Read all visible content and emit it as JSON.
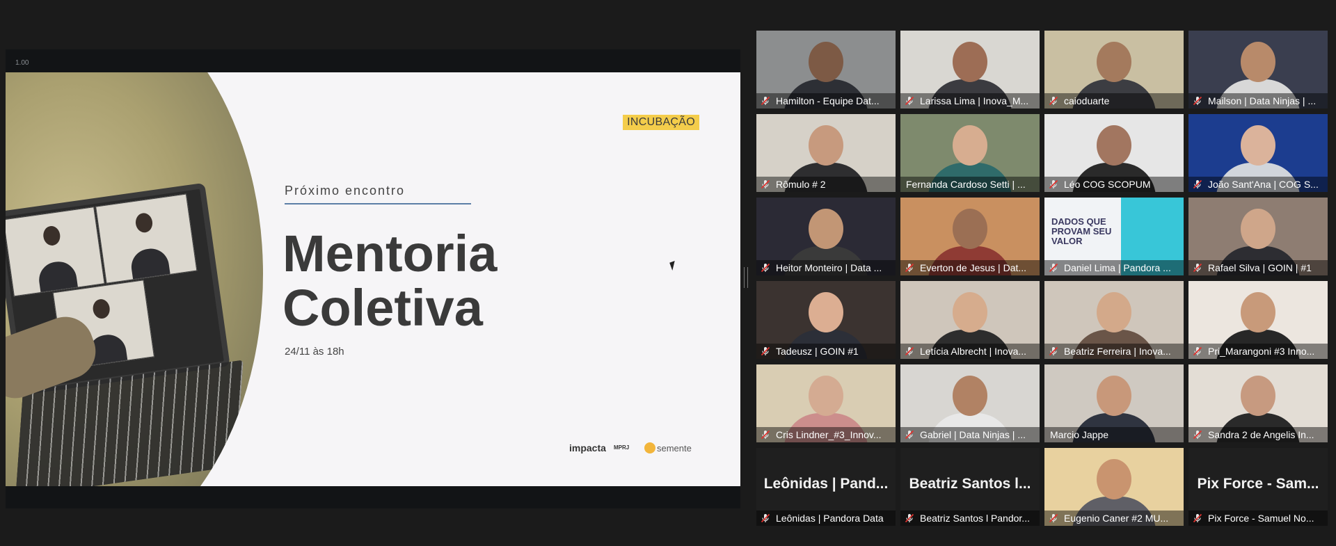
{
  "share": {
    "zoom_level": "1.00",
    "slide": {
      "badge": "INCUBAÇÃO",
      "kicker": "Próximo encontro",
      "title_line1": "Mentoria",
      "title_line2": "Coletiva",
      "date": "24/11 às 18h",
      "logo_impacta": "impacta",
      "logo_mprj": "MPRJ",
      "logo_semente": "semente"
    }
  },
  "gallery": {
    "tiles": [
      {
        "name": "Hamilton - Equipe Dat...",
        "muted": true,
        "bg": "#8c8e8f",
        "skin": "#7d5a45",
        "shirt": "#2d2f35"
      },
      {
        "name": "Larissa Lima | Inova_M...",
        "muted": true,
        "bg": "#d9d7d2",
        "skin": "#9d6d55",
        "shirt": "#3b3b40"
      },
      {
        "name": "caioduarte",
        "muted": true,
        "bg": "#c9bfa2",
        "skin": "#a47a5d",
        "shirt": "#3c3d42"
      },
      {
        "name": "Mailson | Data Ninjas | ...",
        "muted": true,
        "bg": "#3a3e4f",
        "skin": "#b88a6a",
        "shirt": "#d8d8d8"
      },
      {
        "name": "Rômulo # 2",
        "muted": true,
        "bg": "#d6d1c8",
        "skin": "#c79a7e",
        "shirt": "#2e2e30"
      },
      {
        "name": "Fernanda Cardoso Setti | ...",
        "muted": false,
        "bg": "#7e8a6d",
        "skin": "#d7ad90",
        "shirt": "#2f6b6a"
      },
      {
        "name": "Léo COG SCOPUM",
        "muted": true,
        "bg": "#e6e6e6",
        "skin": "#a27660",
        "shirt": "#2a2a2a"
      },
      {
        "name": "João Sant'Ana | COG S...",
        "muted": true,
        "bg": "#1c3d8f",
        "skin": "#dbb39b",
        "shirt": "#d1d5db"
      },
      {
        "name": "Heitor Monteiro | Data ...",
        "muted": true,
        "bg": "#2b2a35",
        "skin": "#c29675",
        "shirt": "#3a3a3a"
      },
      {
        "name": "Everton de Jesus | Dat...",
        "muted": true,
        "bg": "#c99060",
        "skin": "#9b6f54",
        "shirt": "#8f3b34"
      },
      {
        "name": "Daniel Lima | Pandora ...",
        "muted": true,
        "bg": "#f1f3f6",
        "skin": "",
        "shirt": "",
        "poster": true
      },
      {
        "name": "Rafael Silva | GOIN | #1",
        "muted": true,
        "bg": "#8e7d72",
        "skin": "#cfa68a",
        "shirt": "#2d2d32"
      },
      {
        "name": "Tadeusz | GOIN #1",
        "muted": true,
        "bg": "#3b3330",
        "skin": "#dcae92",
        "shirt": "#2c2f38"
      },
      {
        "name": "Letícia Albrecht | Inova...",
        "muted": true,
        "bg": "#cfc6bb",
        "skin": "#d6ac8d",
        "shirt": "#2d2d2d"
      },
      {
        "name": "Beatriz Ferreira | Inova...",
        "muted": true,
        "bg": "#cfc6bb",
        "skin": "#d3a98a",
        "shirt": "#6a5548"
      },
      {
        "name": "Pri_Marangoni #3 Inno...",
        "muted": true,
        "bg": "#ece6df",
        "skin": "#c89a7a",
        "shirt": "#272727"
      },
      {
        "name": "Cris Lindner_#3_Innov...",
        "muted": true,
        "bg": "#d9cdb3",
        "skin": "#d4ab92",
        "shirt": "#cc8e8c"
      },
      {
        "name": "Gabriel | Data Ninjas | ...",
        "muted": true,
        "bg": "#d8d6d2",
        "skin": "#b18264",
        "shirt": "#e8e8e8"
      },
      {
        "name": "Marcio Jappe",
        "muted": false,
        "bg": "#cfc9c1",
        "skin": "#c8987a",
        "shirt": "#2f3440",
        "active": true
      },
      {
        "name": "Sandra 2 de Angelis In...",
        "muted": true,
        "bg": "#e3ddd5",
        "skin": "#c79a80",
        "shirt": "#2a2a2a"
      },
      {
        "name": "Leônidas | Pandora Data",
        "muted": true,
        "big": "Leônidas | Pand..."
      },
      {
        "name": "Beatriz Santos l Pandor...",
        "muted": true,
        "big": "Beatriz Santos l..."
      },
      {
        "name": "Eugenio Caner #2 MU...",
        "muted": true,
        "bg": "#e8d19f",
        "skin": "#c9946f",
        "shirt": "#5f5f66"
      },
      {
        "name": "Pix Force - Samuel No...",
        "muted": true,
        "big": "Pix Force - Sam..."
      }
    ]
  }
}
